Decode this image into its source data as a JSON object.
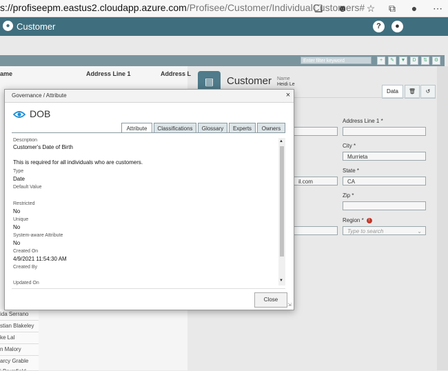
{
  "browser": {
    "url_host": "s://profiseepm.eastus2.cloudapp.azure.com",
    "url_path": "/Profisee/Customer/IndividualCustomers#"
  },
  "app": {
    "title": "Customer",
    "help_label": "?",
    "user_label": "●",
    "header_color": "#3f6f7f"
  },
  "toolbar": {
    "filter_placeholder": "Enter filter keyword"
  },
  "grid": {
    "columns": [
      "ame",
      "Address Line 1",
      "Address L"
    ],
    "rows": [
      "ida Serrano",
      "stian Blakeley",
      "ke Lal",
      "n Malory",
      "arcy Grable",
      "i Brumfield"
    ]
  },
  "record": {
    "title": "Customer",
    "name_label": "Name",
    "name_value": "Heidi Le",
    "tabs": [
      "Data"
    ],
    "fields": {
      "address_line_1_label": "Address Line 1 *",
      "address_line_1_value": "",
      "city_label": "City *",
      "city_value": "Murrieta",
      "email_value": "il.com",
      "state_label": "State *",
      "state_value": "CA",
      "zip_label": "Zip *",
      "region_label": "Region *",
      "region_required_mark": "!",
      "region_placeholder": "Type to search"
    }
  },
  "modal": {
    "title": "Governance / Attribute",
    "close_label": "×",
    "attribute_name": "DOB",
    "tabs": [
      "Attribute",
      "Classifications",
      "Glossary",
      "Experts",
      "Owners"
    ],
    "active_tab": "Attribute",
    "details": {
      "description_label": "Description",
      "description_value": "Customer's Date of Birth",
      "note": "This is required for all individuals who are customers.",
      "type_label": "Type",
      "type_value": "Date",
      "default_label": "Default Value",
      "restricted_label": "Restricted",
      "restricted_value": "No",
      "unique_label": "Unique",
      "unique_value": "No",
      "system_label": "System-aware Attribute",
      "system_value": "No",
      "created_on_label": "Created On",
      "created_on_value": "4/9/2021 11:54:30 AM",
      "created_by_label": "Created By",
      "updated_on_label": "Updated On"
    },
    "close_button": "Close"
  }
}
